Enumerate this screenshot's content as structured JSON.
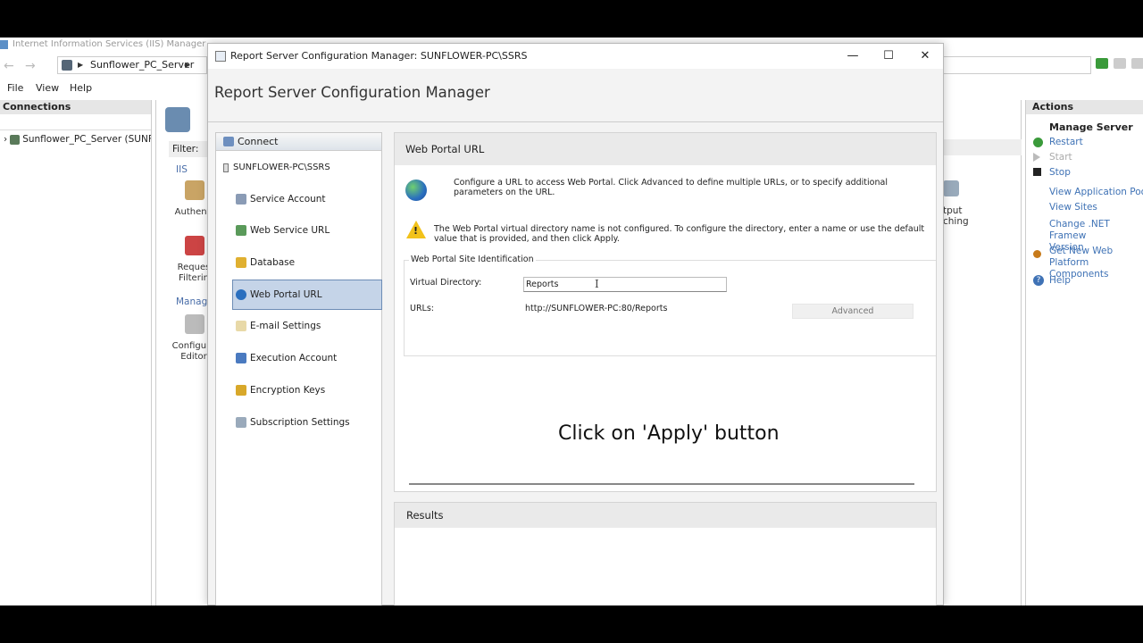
{
  "iis": {
    "window_title": "Internet Information Services (IIS) Manager",
    "address_text": "Sunflower_PC_Server",
    "menu": [
      "File",
      "View",
      "Help"
    ],
    "connections_title": "Connections",
    "tree_node": "Sunflower_PC_Server (SUNFL",
    "filter_label": "Filter:",
    "group_iis": "IIS",
    "features": [
      "Authenti",
      "Reques\nFilterin",
      "Configura\nEditor"
    ],
    "group_manage": "Manage",
    "partial_feature": "tput\nching"
  },
  "actions": {
    "title": "Actions",
    "section": "Manage Server",
    "items": [
      {
        "label": "Restart",
        "enabled": true
      },
      {
        "label": "Start",
        "enabled": false
      },
      {
        "label": "Stop",
        "enabled": true
      },
      {
        "label": "View Application Pools",
        "enabled": true
      },
      {
        "label": "View Sites",
        "enabled": true
      },
      {
        "label": "Change .NET Framew\nVersion",
        "enabled": true
      },
      {
        "label": "Get New Web Platform\nComponents",
        "enabled": true
      },
      {
        "label": "Help",
        "enabled": true
      }
    ]
  },
  "dialog": {
    "title": "Report Server Configuration Manager: SUNFLOWER-PC\\SSRS",
    "header": "Report Server Configuration Manager",
    "connect_label": "Connect",
    "server_label": "SUNFLOWER-PC\\SSRS",
    "nav": [
      {
        "label": "Service Account",
        "selected": false
      },
      {
        "label": "Web Service URL",
        "selected": false
      },
      {
        "label": "Database",
        "selected": false
      },
      {
        "label": "Web Portal URL",
        "selected": true
      },
      {
        "label": "E-mail Settings",
        "selected": false
      },
      {
        "label": "Execution Account",
        "selected": false
      },
      {
        "label": "Encryption Keys",
        "selected": false
      },
      {
        "label": "Subscription Settings",
        "selected": false
      }
    ],
    "panel_title": "Web Portal URL",
    "description": "Configure a URL to access Web Portal.  Click Advanced to define multiple URLs, or to specify additional parameters on the URL.",
    "warning": "The Web Portal virtual directory name is not configured. To configure the directory, enter a name or use the default value that is provided, and then click Apply.",
    "site_identification": "Web Portal Site Identification",
    "virtual_directory_label": "Virtual Directory:",
    "virtual_directory_value": "Reports",
    "urls_label": "URLs:",
    "url_value": "http://SUNFLOWER-PC:80/Reports",
    "advanced_label": "Advanced",
    "results_title": "Results"
  },
  "overlay_caption": "Click on 'Apply' button"
}
